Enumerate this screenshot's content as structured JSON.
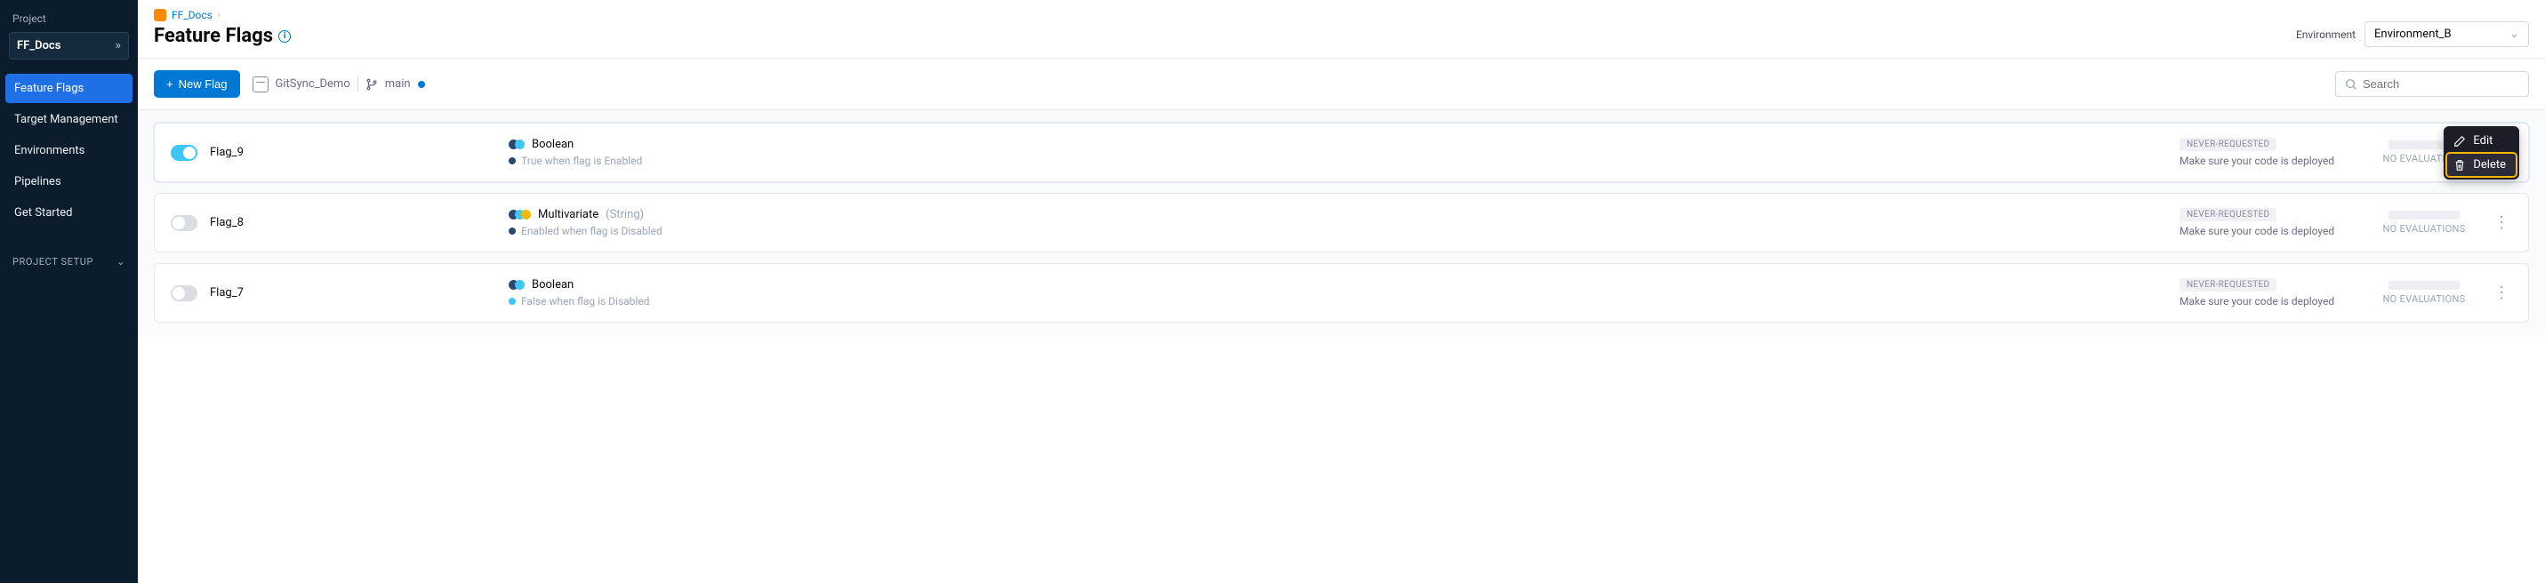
{
  "sidebar": {
    "project_label": "Project",
    "project_name": "FF_Docs",
    "nav": [
      {
        "label": "Feature Flags",
        "active": true
      },
      {
        "label": "Target Management",
        "active": false
      },
      {
        "label": "Environments",
        "active": false
      },
      {
        "label": "Pipelines",
        "active": false
      },
      {
        "label": "Get Started",
        "active": false
      }
    ],
    "project_setup": "PROJECT SETUP"
  },
  "breadcrumb": {
    "project": "FF_Docs"
  },
  "page_title": "Feature Flags",
  "environment": {
    "label": "Environment",
    "selected": "Environment_B"
  },
  "toolbar": {
    "new_flag": "New Flag",
    "git_repo": "GitSync_Demo",
    "branch": "main",
    "search_placeholder": "Search"
  },
  "flags": [
    {
      "name": "Flag_9",
      "enabled": true,
      "type": "Boolean",
      "type_sub": "",
      "variant_dots": 2,
      "desc_dot_color": "#2c4870",
      "desc": "True when flag is Enabled",
      "badge": "NEVER-REQUESTED",
      "status_text": "Make sure your code is deployed",
      "eval": "NO EVALUATIONS"
    },
    {
      "name": "Flag_8",
      "enabled": false,
      "type": "Multivariate",
      "type_sub": "(String)",
      "variant_dots": 3,
      "desc_dot_color": "#2c4870",
      "desc": "Enabled when flag is Disabled",
      "badge": "NEVER-REQUESTED",
      "status_text": "Make sure your code is deployed",
      "eval": "NO EVALUATIONS"
    },
    {
      "name": "Flag_7",
      "enabled": false,
      "type": "Boolean",
      "type_sub": "",
      "variant_dots": 2,
      "desc_dot_color": "#3dc7f6",
      "desc": "False when flag is Disabled",
      "badge": "NEVER-REQUESTED",
      "status_text": "Make sure your code is deployed",
      "eval": "NO EVALUATIONS"
    }
  ],
  "context_menu": {
    "edit": "Edit",
    "delete": "Delete"
  }
}
